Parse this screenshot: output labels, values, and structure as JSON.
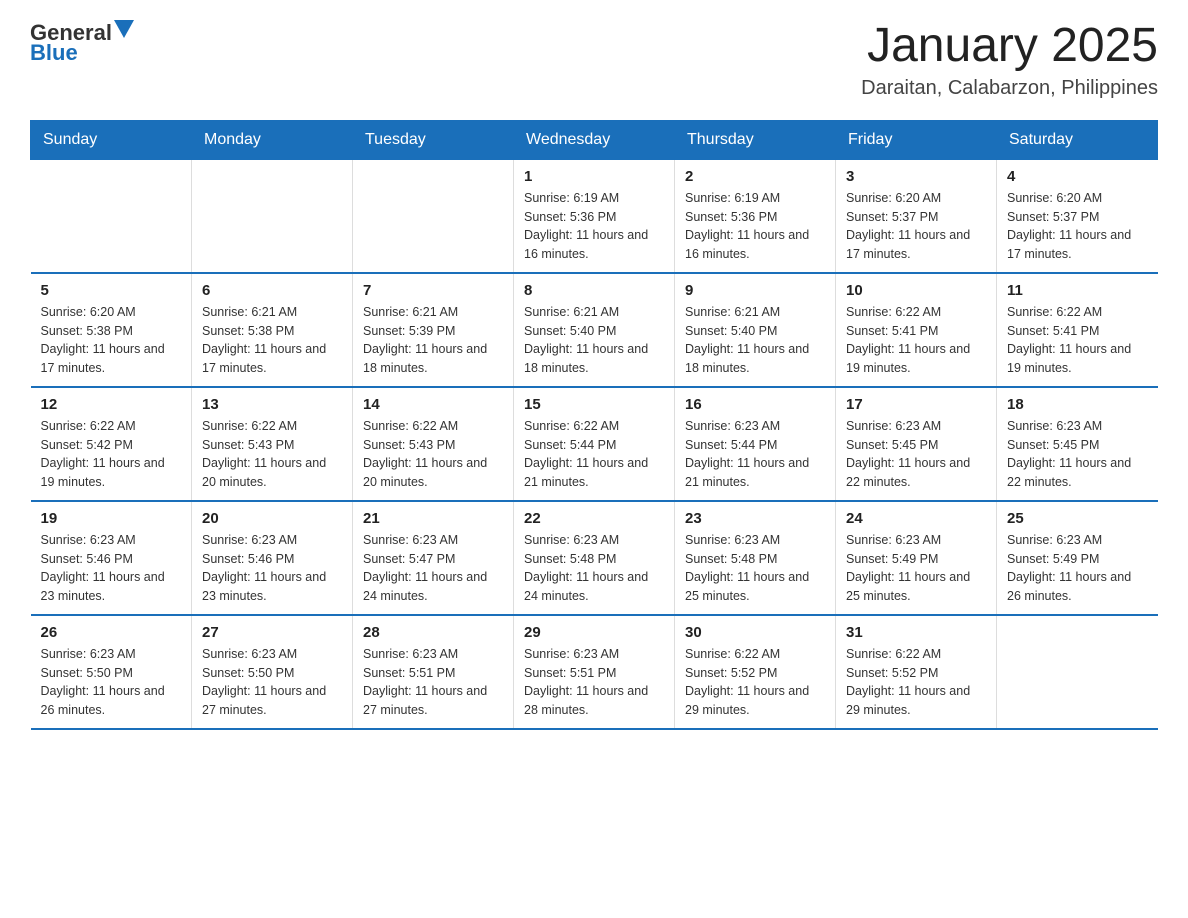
{
  "header": {
    "logo_general": "General",
    "logo_blue": "Blue",
    "month_title": "January 2025",
    "location": "Daraitan, Calabarzon, Philippines"
  },
  "days_of_week": [
    "Sunday",
    "Monday",
    "Tuesday",
    "Wednesday",
    "Thursday",
    "Friday",
    "Saturday"
  ],
  "weeks": [
    [
      {
        "day": "",
        "info": ""
      },
      {
        "day": "",
        "info": ""
      },
      {
        "day": "",
        "info": ""
      },
      {
        "day": "1",
        "info": "Sunrise: 6:19 AM\nSunset: 5:36 PM\nDaylight: 11 hours and 16 minutes."
      },
      {
        "day": "2",
        "info": "Sunrise: 6:19 AM\nSunset: 5:36 PM\nDaylight: 11 hours and 16 minutes."
      },
      {
        "day": "3",
        "info": "Sunrise: 6:20 AM\nSunset: 5:37 PM\nDaylight: 11 hours and 17 minutes."
      },
      {
        "day": "4",
        "info": "Sunrise: 6:20 AM\nSunset: 5:37 PM\nDaylight: 11 hours and 17 minutes."
      }
    ],
    [
      {
        "day": "5",
        "info": "Sunrise: 6:20 AM\nSunset: 5:38 PM\nDaylight: 11 hours and 17 minutes."
      },
      {
        "day": "6",
        "info": "Sunrise: 6:21 AM\nSunset: 5:38 PM\nDaylight: 11 hours and 17 minutes."
      },
      {
        "day": "7",
        "info": "Sunrise: 6:21 AM\nSunset: 5:39 PM\nDaylight: 11 hours and 18 minutes."
      },
      {
        "day": "8",
        "info": "Sunrise: 6:21 AM\nSunset: 5:40 PM\nDaylight: 11 hours and 18 minutes."
      },
      {
        "day": "9",
        "info": "Sunrise: 6:21 AM\nSunset: 5:40 PM\nDaylight: 11 hours and 18 minutes."
      },
      {
        "day": "10",
        "info": "Sunrise: 6:22 AM\nSunset: 5:41 PM\nDaylight: 11 hours and 19 minutes."
      },
      {
        "day": "11",
        "info": "Sunrise: 6:22 AM\nSunset: 5:41 PM\nDaylight: 11 hours and 19 minutes."
      }
    ],
    [
      {
        "day": "12",
        "info": "Sunrise: 6:22 AM\nSunset: 5:42 PM\nDaylight: 11 hours and 19 minutes."
      },
      {
        "day": "13",
        "info": "Sunrise: 6:22 AM\nSunset: 5:43 PM\nDaylight: 11 hours and 20 minutes."
      },
      {
        "day": "14",
        "info": "Sunrise: 6:22 AM\nSunset: 5:43 PM\nDaylight: 11 hours and 20 minutes."
      },
      {
        "day": "15",
        "info": "Sunrise: 6:22 AM\nSunset: 5:44 PM\nDaylight: 11 hours and 21 minutes."
      },
      {
        "day": "16",
        "info": "Sunrise: 6:23 AM\nSunset: 5:44 PM\nDaylight: 11 hours and 21 minutes."
      },
      {
        "day": "17",
        "info": "Sunrise: 6:23 AM\nSunset: 5:45 PM\nDaylight: 11 hours and 22 minutes."
      },
      {
        "day": "18",
        "info": "Sunrise: 6:23 AM\nSunset: 5:45 PM\nDaylight: 11 hours and 22 minutes."
      }
    ],
    [
      {
        "day": "19",
        "info": "Sunrise: 6:23 AM\nSunset: 5:46 PM\nDaylight: 11 hours and 23 minutes."
      },
      {
        "day": "20",
        "info": "Sunrise: 6:23 AM\nSunset: 5:46 PM\nDaylight: 11 hours and 23 minutes."
      },
      {
        "day": "21",
        "info": "Sunrise: 6:23 AM\nSunset: 5:47 PM\nDaylight: 11 hours and 24 minutes."
      },
      {
        "day": "22",
        "info": "Sunrise: 6:23 AM\nSunset: 5:48 PM\nDaylight: 11 hours and 24 minutes."
      },
      {
        "day": "23",
        "info": "Sunrise: 6:23 AM\nSunset: 5:48 PM\nDaylight: 11 hours and 25 minutes."
      },
      {
        "day": "24",
        "info": "Sunrise: 6:23 AM\nSunset: 5:49 PM\nDaylight: 11 hours and 25 minutes."
      },
      {
        "day": "25",
        "info": "Sunrise: 6:23 AM\nSunset: 5:49 PM\nDaylight: 11 hours and 26 minutes."
      }
    ],
    [
      {
        "day": "26",
        "info": "Sunrise: 6:23 AM\nSunset: 5:50 PM\nDaylight: 11 hours and 26 minutes."
      },
      {
        "day": "27",
        "info": "Sunrise: 6:23 AM\nSunset: 5:50 PM\nDaylight: 11 hours and 27 minutes."
      },
      {
        "day": "28",
        "info": "Sunrise: 6:23 AM\nSunset: 5:51 PM\nDaylight: 11 hours and 27 minutes."
      },
      {
        "day": "29",
        "info": "Sunrise: 6:23 AM\nSunset: 5:51 PM\nDaylight: 11 hours and 28 minutes."
      },
      {
        "day": "30",
        "info": "Sunrise: 6:22 AM\nSunset: 5:52 PM\nDaylight: 11 hours and 29 minutes."
      },
      {
        "day": "31",
        "info": "Sunrise: 6:22 AM\nSunset: 5:52 PM\nDaylight: 11 hours and 29 minutes."
      },
      {
        "day": "",
        "info": ""
      }
    ]
  ]
}
